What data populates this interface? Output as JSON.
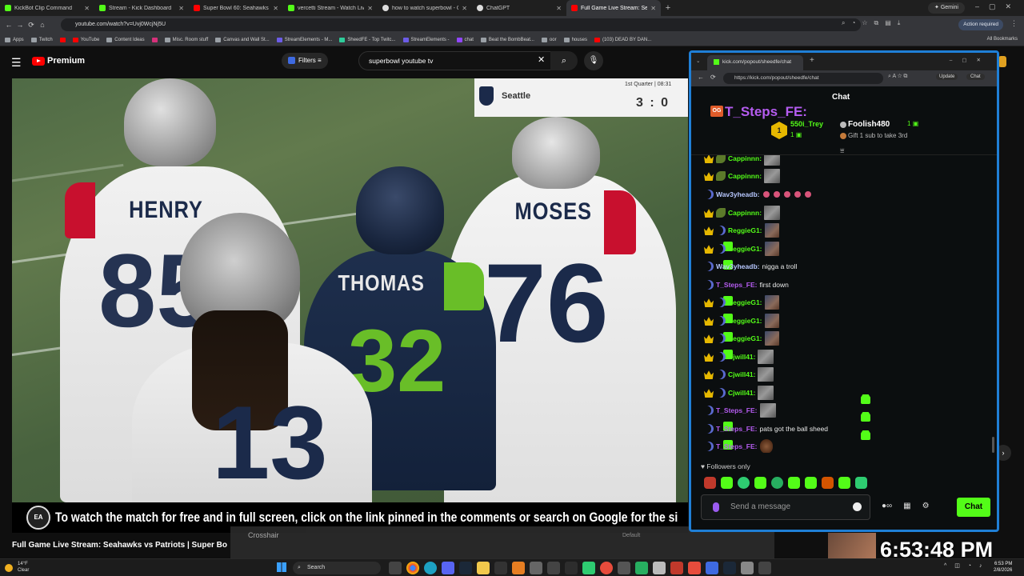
{
  "browser": {
    "tabs": [
      {
        "title": "KickBot Clip Command",
        "color": "#53fc18"
      },
      {
        "title": "Stream - Kick Dashboard",
        "color": "#53fc18"
      },
      {
        "title": "Super Bowl 60: Seahawks vs Pa",
        "color": "#ff0000"
      },
      {
        "title": "vercetti Stream - Watch Live on",
        "color": "#53fc18"
      },
      {
        "title": "how to watch superbowl - Goo",
        "color": "#dddddd"
      },
      {
        "title": "ChatGPT",
        "color": "#dddddd"
      },
      {
        "title": "Full Game Live Stream: Seahaw",
        "color": "#ff0000"
      }
    ],
    "gemini_label": "Gemini",
    "url": "youtube.com/watch?v=Uvj0WcjNj5U",
    "action_required": "Action required",
    "bookmarks": [
      "Apps",
      "Twitch",
      "",
      "YouTube",
      "Content Ideas",
      "",
      "Misc. Room stuff",
      "Canvas and Wall St...",
      "StreamElements - M...",
      "SheedFE - Top Twitc...",
      "StreamElements -",
      "chat",
      "Beat the BombBeat...",
      "oor",
      "houses",
      "(103) DEAD BY DAN..."
    ],
    "all_bookmarks": "All Bookmarks"
  },
  "youtube": {
    "logo_text": "Premium",
    "filters_label": "Filters",
    "search_query": "superbowl youtube tv",
    "video_title": "Full Game Live Stream: Seahawks vs Patriots | Super Bo",
    "subtitle": "To watch the match for free and in full screen, click on the link pinned in the comments or search on Google for the si",
    "ea_badge": "EA",
    "scorebug": {
      "team": "Seattle",
      "quarter": "1st Quarter | 08:31",
      "score": "3 : 0"
    },
    "players": {
      "p1_name": "HENRY",
      "p1_num": "85",
      "p2_name": "MOSES",
      "p2_num": "76",
      "p3_name": "THOMAS",
      "p3_num": "32",
      "p4_num": "13"
    },
    "crosshair_label": "Crosshair",
    "crosshair_default": "Default",
    "clock_overlay": "6:53:48 PM"
  },
  "kick": {
    "tab_title": "kick.com/popout/sheedfe/chat",
    "url": "https://kick.com/popout/sheedfe/chat",
    "update_label": "Update",
    "chat_btn_label": "Chat",
    "header_title": "Chat",
    "og_badge": "OG",
    "pinned_user": "T_Steps_FE:",
    "gifter_rank": "1",
    "gifter_name": "550i_Trey",
    "gifter_count": "1",
    "leader_name": "Foolish480",
    "leader_count": "1",
    "gift_prompt": "Gift 1 sub to take 3rd",
    "messages": [
      {
        "user": "Cappinnn:",
        "color": "#53fc18",
        "text": ""
      },
      {
        "user": "Cappinnn:",
        "color": "#53fc18",
        "text": ""
      },
      {
        "user": "Wav3yheadb:",
        "color": "#b8c8ff",
        "text": ""
      },
      {
        "user": "Cappinnn:",
        "color": "#53fc18",
        "text": ""
      },
      {
        "user": "ReggieG1:",
        "color": "#53fc18",
        "text": ""
      },
      {
        "user": "ReggieG1:",
        "color": "#53fc18",
        "text": ""
      },
      {
        "user": "Wav3yheadb:",
        "color": "#b8c8ff",
        "text": "nigga a troll"
      },
      {
        "user": "T_Steps_FE:",
        "color": "#b55cf0",
        "text": "first down"
      },
      {
        "user": "ReggieG1:",
        "color": "#53fc18",
        "text": ""
      },
      {
        "user": "ReggieG1:",
        "color": "#53fc18",
        "text": ""
      },
      {
        "user": "ReggieG1:",
        "color": "#53fc18",
        "text": ""
      },
      {
        "user": "Cjwill41:",
        "color": "#53fc18",
        "text": ""
      },
      {
        "user": "Cjwill41:",
        "color": "#53fc18",
        "text": ""
      },
      {
        "user": "Cjwill41:",
        "color": "#53fc18",
        "text": ""
      },
      {
        "user": "T_Steps_FE:",
        "color": "#b55cf0",
        "text": ""
      },
      {
        "user": "T_Steps_FE:",
        "color": "#b55cf0",
        "text": "pats got the ball sheed"
      },
      {
        "user": "T_Steps_FE:",
        "color": "#b55cf0",
        "text": ""
      }
    ],
    "followers_only": "Followers only",
    "message_placeholder": "Send a message",
    "send_label": "Chat"
  },
  "taskbar": {
    "temp": "14°F",
    "condition": "Clear",
    "search_label": "Search",
    "time": "6:53 PM",
    "date": "2/8/2026"
  }
}
